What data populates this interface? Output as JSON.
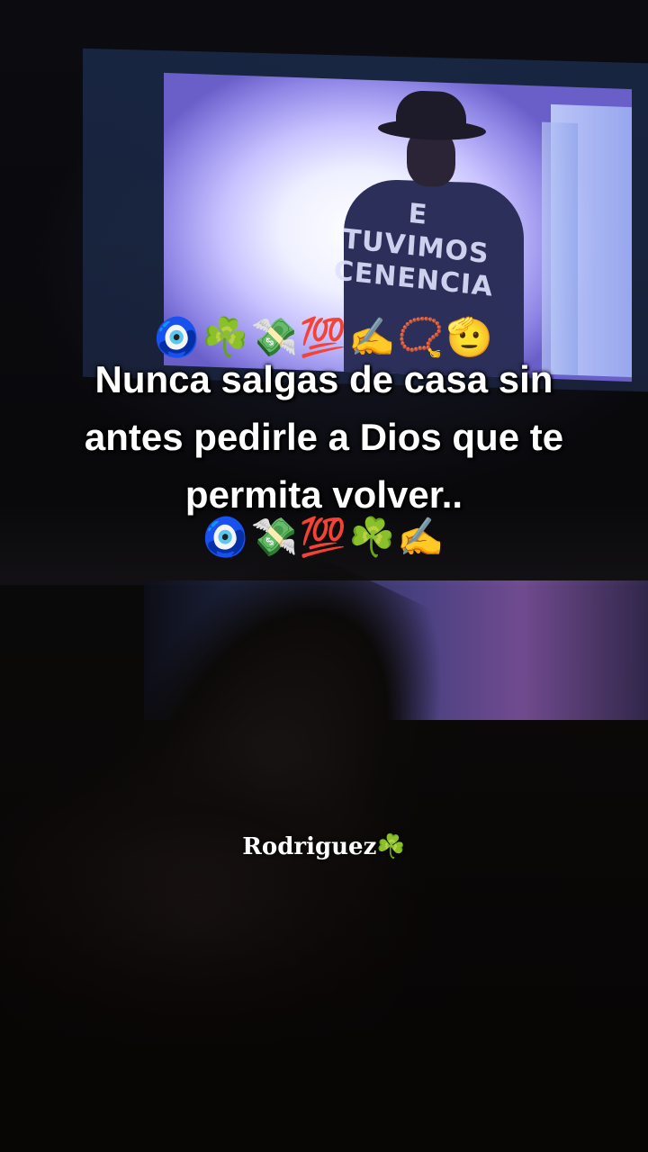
{
  "tv": {
    "shirt_text_line1": "E TUVIMOS",
    "shirt_text_line2": "CENENCIA"
  },
  "overlay": {
    "emoji_top": "🧿☘️💸💯✍️📿🫡",
    "caption_line1": "Nunca salgas de casa sin",
    "caption_line2": "antes pedirle a Dios que te",
    "caption_line3": "permita volver..",
    "emoji_bottom": "🧿💸💯☘️✍️"
  },
  "signature": "Rodriguez☘️",
  "colors": {
    "text": "#ffffff",
    "tv_glow": "#c8c2ff",
    "background": "#050505"
  }
}
